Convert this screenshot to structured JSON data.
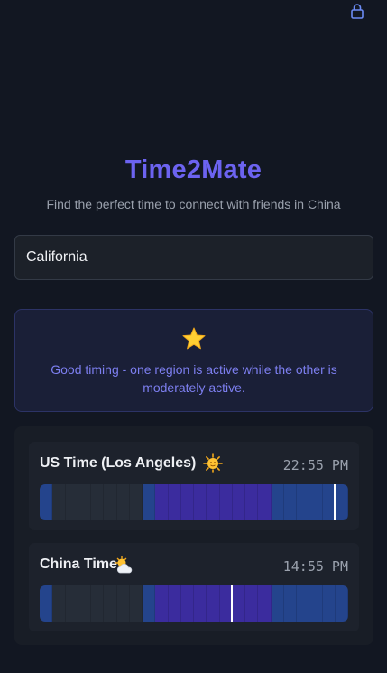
{
  "app": {
    "title": "Time2Mate",
    "subtitle": "Find the perfect time to connect with friends in China"
  },
  "location": {
    "value": "California"
  },
  "status": {
    "icon": "star-icon",
    "message": "Good timing - one region is active while the other is moderately active."
  },
  "colors": {
    "accent": "#6c63f0",
    "activity_low": "#262d38",
    "activity_moderate": "#24448c",
    "activity_high": "#3b2c9e",
    "marker": "#ffffff"
  },
  "clocks": [
    {
      "label": "US Time (Los Angeles)",
      "time": "22:55 PM",
      "icon": "sun-face-icon",
      "current_hour": 22.92,
      "hours": [
        "mid",
        "low",
        "low",
        "low",
        "low",
        "low",
        "low",
        "low",
        "mid",
        "high",
        "high",
        "high",
        "high",
        "high",
        "high",
        "high",
        "high",
        "high",
        "mid",
        "mid",
        "mid",
        "mid",
        "mid",
        "mid"
      ]
    },
    {
      "label": "China Time",
      "time": "14:55 PM",
      "icon": "sun-behind-cloud-icon",
      "current_hour": 14.92,
      "hours": [
        "mid",
        "low",
        "low",
        "low",
        "low",
        "low",
        "low",
        "low",
        "mid",
        "high",
        "high",
        "high",
        "high",
        "high",
        "high",
        "high",
        "high",
        "high",
        "mid",
        "mid",
        "mid",
        "mid",
        "mid",
        "mid"
      ]
    }
  ]
}
